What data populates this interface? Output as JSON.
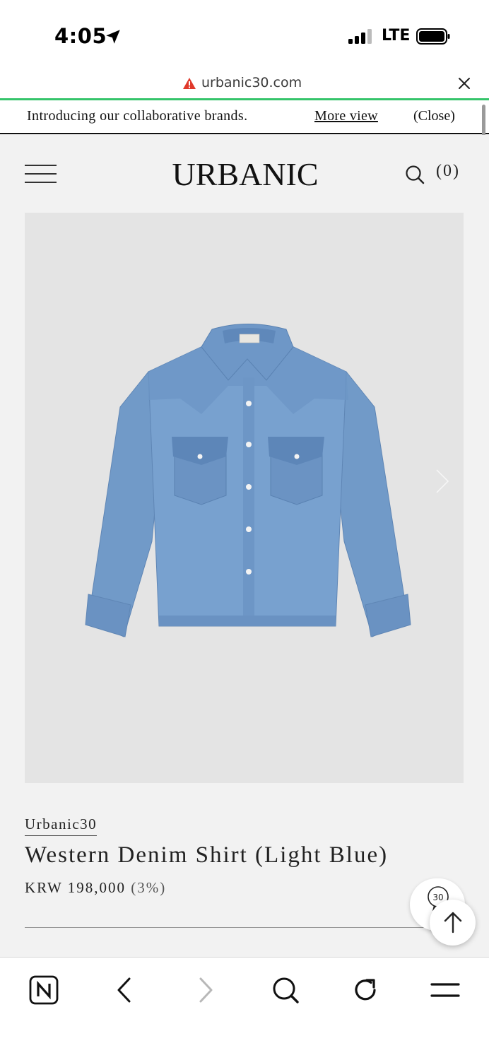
{
  "status_bar": {
    "time": "4:05",
    "network": "LTE"
  },
  "address_bar": {
    "url": "urbanic30.com"
  },
  "announcement": {
    "text": "Introducing our collaborative brands.",
    "more_label": "More view",
    "close_label": "(Close)"
  },
  "header": {
    "logo_text": "URBANIC",
    "cart_count": "(0)"
  },
  "product": {
    "brand": "Urbanic30",
    "title": "Western Denim Shirt (Light Blue)",
    "price": "KRW 198,000",
    "discount": "(3%)"
  },
  "floating": {
    "badge_text": "30"
  },
  "colors": {
    "progress": "#35c46a",
    "warning": "#e0392b",
    "page_bg": "#f2f2f2",
    "image_bg": "#e4e4e4",
    "denim": "#6f98c8"
  },
  "toolbar": {
    "icons": [
      "naver-n-icon",
      "back-icon",
      "forward-icon",
      "search-icon",
      "reload-icon",
      "menu-icon"
    ]
  }
}
